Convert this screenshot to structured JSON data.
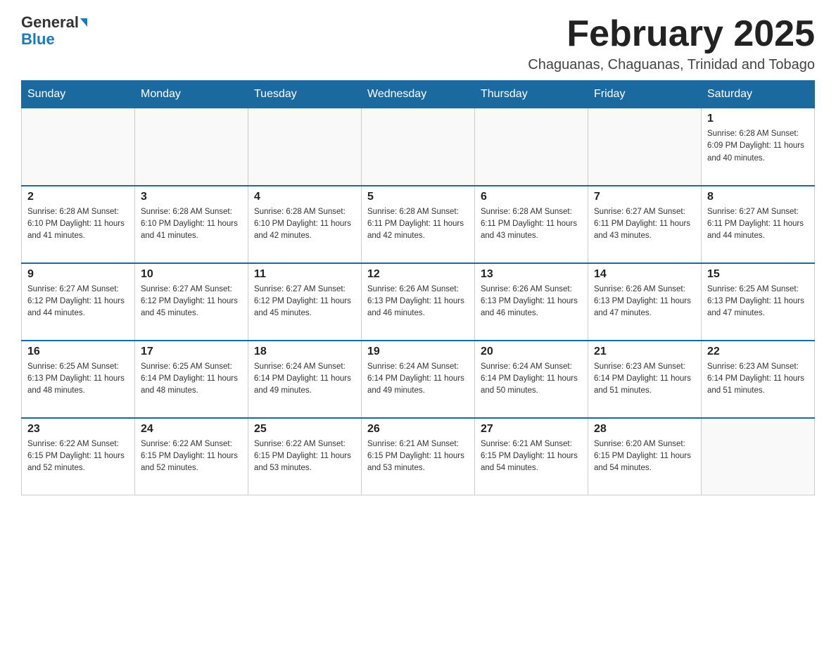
{
  "logo": {
    "general": "General",
    "blue": "Blue",
    "arrow": "▶"
  },
  "title": "February 2025",
  "subtitle": "Chaguanas, Chaguanas, Trinidad and Tobago",
  "days_of_week": [
    "Sunday",
    "Monday",
    "Tuesday",
    "Wednesday",
    "Thursday",
    "Friday",
    "Saturday"
  ],
  "weeks": [
    [
      {
        "day": "",
        "info": ""
      },
      {
        "day": "",
        "info": ""
      },
      {
        "day": "",
        "info": ""
      },
      {
        "day": "",
        "info": ""
      },
      {
        "day": "",
        "info": ""
      },
      {
        "day": "",
        "info": ""
      },
      {
        "day": "1",
        "info": "Sunrise: 6:28 AM\nSunset: 6:09 PM\nDaylight: 11 hours\nand 40 minutes."
      }
    ],
    [
      {
        "day": "2",
        "info": "Sunrise: 6:28 AM\nSunset: 6:10 PM\nDaylight: 11 hours\nand 41 minutes."
      },
      {
        "day": "3",
        "info": "Sunrise: 6:28 AM\nSunset: 6:10 PM\nDaylight: 11 hours\nand 41 minutes."
      },
      {
        "day": "4",
        "info": "Sunrise: 6:28 AM\nSunset: 6:10 PM\nDaylight: 11 hours\nand 42 minutes."
      },
      {
        "day": "5",
        "info": "Sunrise: 6:28 AM\nSunset: 6:11 PM\nDaylight: 11 hours\nand 42 minutes."
      },
      {
        "day": "6",
        "info": "Sunrise: 6:28 AM\nSunset: 6:11 PM\nDaylight: 11 hours\nand 43 minutes."
      },
      {
        "day": "7",
        "info": "Sunrise: 6:27 AM\nSunset: 6:11 PM\nDaylight: 11 hours\nand 43 minutes."
      },
      {
        "day": "8",
        "info": "Sunrise: 6:27 AM\nSunset: 6:11 PM\nDaylight: 11 hours\nand 44 minutes."
      }
    ],
    [
      {
        "day": "9",
        "info": "Sunrise: 6:27 AM\nSunset: 6:12 PM\nDaylight: 11 hours\nand 44 minutes."
      },
      {
        "day": "10",
        "info": "Sunrise: 6:27 AM\nSunset: 6:12 PM\nDaylight: 11 hours\nand 45 minutes."
      },
      {
        "day": "11",
        "info": "Sunrise: 6:27 AM\nSunset: 6:12 PM\nDaylight: 11 hours\nand 45 minutes."
      },
      {
        "day": "12",
        "info": "Sunrise: 6:26 AM\nSunset: 6:13 PM\nDaylight: 11 hours\nand 46 minutes."
      },
      {
        "day": "13",
        "info": "Sunrise: 6:26 AM\nSunset: 6:13 PM\nDaylight: 11 hours\nand 46 minutes."
      },
      {
        "day": "14",
        "info": "Sunrise: 6:26 AM\nSunset: 6:13 PM\nDaylight: 11 hours\nand 47 minutes."
      },
      {
        "day": "15",
        "info": "Sunrise: 6:25 AM\nSunset: 6:13 PM\nDaylight: 11 hours\nand 47 minutes."
      }
    ],
    [
      {
        "day": "16",
        "info": "Sunrise: 6:25 AM\nSunset: 6:13 PM\nDaylight: 11 hours\nand 48 minutes."
      },
      {
        "day": "17",
        "info": "Sunrise: 6:25 AM\nSunset: 6:14 PM\nDaylight: 11 hours\nand 48 minutes."
      },
      {
        "day": "18",
        "info": "Sunrise: 6:24 AM\nSunset: 6:14 PM\nDaylight: 11 hours\nand 49 minutes."
      },
      {
        "day": "19",
        "info": "Sunrise: 6:24 AM\nSunset: 6:14 PM\nDaylight: 11 hours\nand 49 minutes."
      },
      {
        "day": "20",
        "info": "Sunrise: 6:24 AM\nSunset: 6:14 PM\nDaylight: 11 hours\nand 50 minutes."
      },
      {
        "day": "21",
        "info": "Sunrise: 6:23 AM\nSunset: 6:14 PM\nDaylight: 11 hours\nand 51 minutes."
      },
      {
        "day": "22",
        "info": "Sunrise: 6:23 AM\nSunset: 6:14 PM\nDaylight: 11 hours\nand 51 minutes."
      }
    ],
    [
      {
        "day": "23",
        "info": "Sunrise: 6:22 AM\nSunset: 6:15 PM\nDaylight: 11 hours\nand 52 minutes."
      },
      {
        "day": "24",
        "info": "Sunrise: 6:22 AM\nSunset: 6:15 PM\nDaylight: 11 hours\nand 52 minutes."
      },
      {
        "day": "25",
        "info": "Sunrise: 6:22 AM\nSunset: 6:15 PM\nDaylight: 11 hours\nand 53 minutes."
      },
      {
        "day": "26",
        "info": "Sunrise: 6:21 AM\nSunset: 6:15 PM\nDaylight: 11 hours\nand 53 minutes."
      },
      {
        "day": "27",
        "info": "Sunrise: 6:21 AM\nSunset: 6:15 PM\nDaylight: 11 hours\nand 54 minutes."
      },
      {
        "day": "28",
        "info": "Sunrise: 6:20 AM\nSunset: 6:15 PM\nDaylight: 11 hours\nand 54 minutes."
      },
      {
        "day": "",
        "info": ""
      }
    ]
  ]
}
